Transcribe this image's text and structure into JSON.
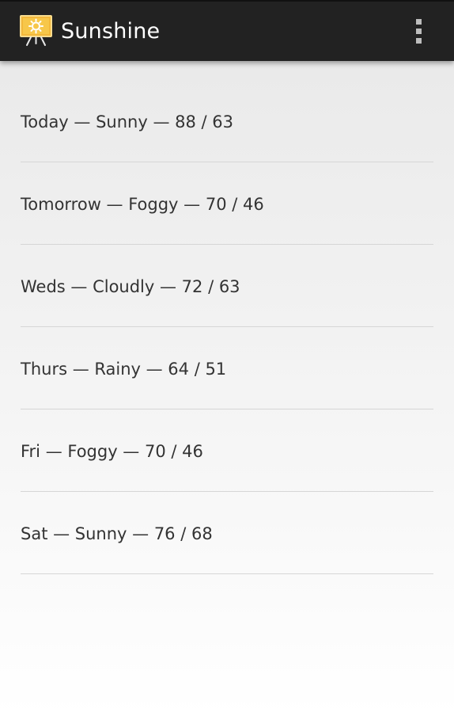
{
  "action_bar": {
    "title": "Sunshine",
    "app_icon": "sunshine-app-icon",
    "overflow_icon": "overflow-menu-icon"
  },
  "forecast": [
    "Today — Sunny — 88 / 63",
    "Tomorrow — Foggy — 70 / 46",
    "Weds — Cloudly — 72 / 63",
    "Thurs — Rainy — 64 / 51",
    "Fri — Foggy — 70 / 46",
    "Sat — Sunny — 76 / 68"
  ],
  "colors": {
    "action_bar_bg": "#222222",
    "title_text": "#ffffff",
    "item_text": "#333333",
    "divider": "#d6d6d6",
    "icon_yellow": "#f7c74a"
  }
}
